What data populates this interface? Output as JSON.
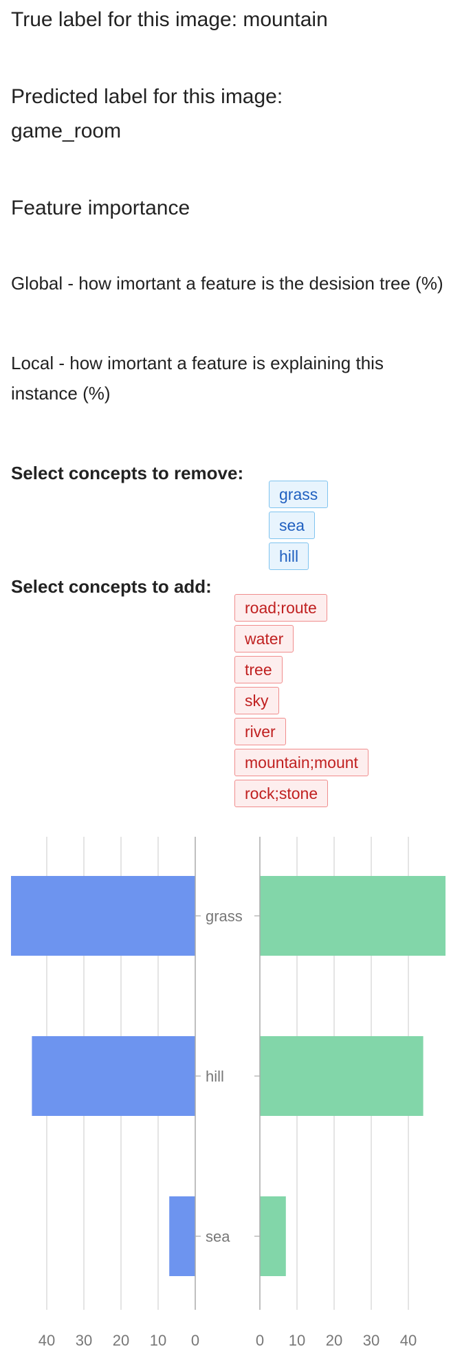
{
  "true_label": "True label for this image: mountain",
  "predicted_label_line1": "Predicted label for this image:",
  "predicted_label_line2": "game_room",
  "feature_importance_heading": "Feature importance",
  "global_description": "Global - how imortant a feature is the desision tree (%)",
  "local_description": "Local - how imortant a feature is explaining this instance (%)",
  "remove_label": "Select concepts to remove:",
  "remove_concepts": [
    "grass",
    "sea",
    "hill"
  ],
  "add_label": "Select concepts to add:",
  "add_concepts": [
    "road;route",
    "water",
    "tree",
    "sky",
    "river",
    "mountain;mount",
    "rock;stone"
  ],
  "colors": {
    "global": "#6d94ef",
    "local": "#82d6a9",
    "remove_tag_text": "#2060c0",
    "add_tag_text": "#c02020"
  },
  "chart_data": {
    "type": "bar",
    "orientation": "horizontal",
    "layout": "back-to-back",
    "categories": [
      "grass",
      "hill",
      "sea"
    ],
    "series": [
      {
        "values": [
          50,
          44,
          7
        ],
        "direction": "left"
      },
      {
        "values": [
          50,
          44,
          7
        ],
        "direction": "right"
      }
    ],
    "xlim": [
      0,
      50
    ],
    "xticks": [
      0,
      10,
      20,
      30,
      40
    ],
    "grid": true
  }
}
